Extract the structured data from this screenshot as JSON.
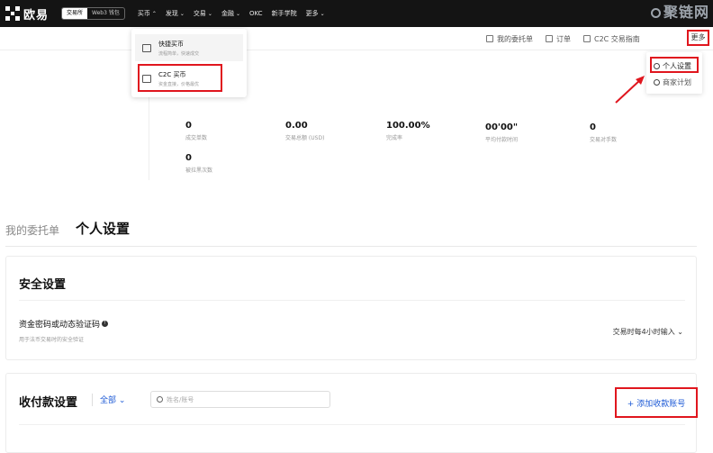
{
  "topnav": {
    "logo_text": "欧易",
    "mode_buttons": [
      "交易所",
      "Web3 钱包"
    ],
    "items": [
      {
        "label": "买币",
        "chevron": "⌃"
      },
      {
        "label": "发现",
        "chevron": "⌄"
      },
      {
        "label": "交易",
        "chevron": "⌄"
      },
      {
        "label": "金融",
        "chevron": "⌄"
      },
      {
        "label": "OKC",
        "chevron": ""
      },
      {
        "label": "新手学院",
        "chevron": ""
      },
      {
        "label": "更多",
        "chevron": "⌄"
      }
    ]
  },
  "watermark": "聚链网",
  "subheader": {
    "links": [
      "我的委托单",
      "订单",
      "C2C 交易指南"
    ],
    "more_label": "更多"
  },
  "buy_dropdown": {
    "items": [
      {
        "title": "快捷买币",
        "subtitle": "流程简单，快速成交"
      },
      {
        "title": "C2C 买币",
        "subtitle": "资金直接，价格最优"
      }
    ]
  },
  "more_menu": {
    "items": [
      "个人设置",
      "商家计划"
    ]
  },
  "stats": [
    {
      "value": "0",
      "label": "成交单数"
    },
    {
      "value": "0.00",
      "label": "交易总额 (USD)"
    },
    {
      "value": "100.00%",
      "label": "完成率"
    },
    {
      "value": "00'00\"",
      "label": "平均付款时间"
    },
    {
      "value": "0",
      "label": "交易对手数"
    },
    {
      "value": "0",
      "label": "被拉黑次数"
    }
  ],
  "tabs": [
    "我的委托单",
    "个人设置"
  ],
  "security": {
    "title": "安全设置",
    "item_label": "资金密码或动态验证码",
    "item_desc": "用于法币交易时的安全验证",
    "item_value": "交易时每4小时输入 ⌄"
  },
  "payment": {
    "title": "收付款设置",
    "filter_label": "全部 ⌄",
    "search_placeholder": "姓名/账号",
    "add_button": "+ 添加收款账号"
  },
  "colors": {
    "highlight": "#e0161e",
    "link": "#1f5bd6",
    "nav_bg": "#141414"
  }
}
